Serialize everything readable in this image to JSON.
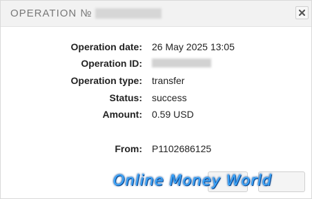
{
  "dialog": {
    "title": "OPERATION №",
    "close_icon": "close-x-icon"
  },
  "details": {
    "date_label": "Operation date:",
    "date_value": "26 May 2025 13:05",
    "id_label": "Operation ID:",
    "type_label": "Operation type:",
    "type_value": "transfer",
    "status_label": "Status:",
    "status_value": "success",
    "amount_label": "Amount:",
    "amount_value": "0.59 USD",
    "from_label": "From:",
    "from_value": "P1102686125"
  },
  "watermark": {
    "text": "Online Money World",
    "color": "#3aa7ff"
  }
}
